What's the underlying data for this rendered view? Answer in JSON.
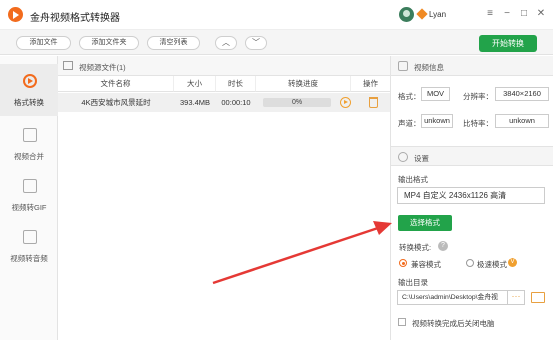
{
  "app": {
    "title": "金舟视频格式转换器",
    "user_name": "Lyan"
  },
  "window_controls": {
    "menu": "≡",
    "minimize": "−",
    "maximize": "□",
    "close": "✕"
  },
  "toolbar": {
    "add_file": "添加文件",
    "add_folder": "添加文件夹",
    "clear_list": "清空列表",
    "move_up": "︿",
    "move_down": "﹀",
    "start_convert": "开始转换"
  },
  "sidebar": {
    "items": [
      {
        "label": "格式转换",
        "icon": "convert-icon",
        "active": true
      },
      {
        "label": "视频合并",
        "icon": "merge-icon",
        "active": false
      },
      {
        "label": "视频转GIF",
        "icon": "gif-icon",
        "active": false
      },
      {
        "label": "视频转音频",
        "icon": "audio-icon",
        "active": false
      }
    ]
  },
  "file_panel": {
    "title": "视频源文件(1)",
    "columns": [
      "文件名称",
      "大小",
      "时长",
      "转换进度",
      "操作"
    ],
    "rows": [
      {
        "name": "4K西安城市风景延时",
        "size": "393.4MB",
        "duration": "00:00:10",
        "progress": "0%",
        "progress_value": 0
      }
    ]
  },
  "video_info": {
    "title": "视频信息",
    "format_label": "格式：",
    "format_value": "MOV",
    "resolution_label": "分辨率：",
    "resolution_value": "3840×2160",
    "audio_label": "声道：",
    "audio_value": "unkown",
    "bitrate_label": "比特率：",
    "bitrate_value": "unkown"
  },
  "settings": {
    "title": "设置",
    "output_format_label": "输出格式",
    "output_format_value": "MP4 自定义 2436x1126 高清",
    "select_format_button": "选择格式",
    "convert_mode_label": "转换模式:",
    "mode_compatible": "兼容模式",
    "mode_fast": "极速模式",
    "output_dir_label": "输出目录",
    "output_dir_value": "C:\\Users\\admin\\Desktop\\金舟视",
    "more_button": "···",
    "shutdown_label": "视频转换完成后关闭电脑"
  },
  "colors": {
    "accent_green": "#22a34a",
    "accent_orange": "#f26b1d",
    "arrow_red": "#e53935"
  }
}
